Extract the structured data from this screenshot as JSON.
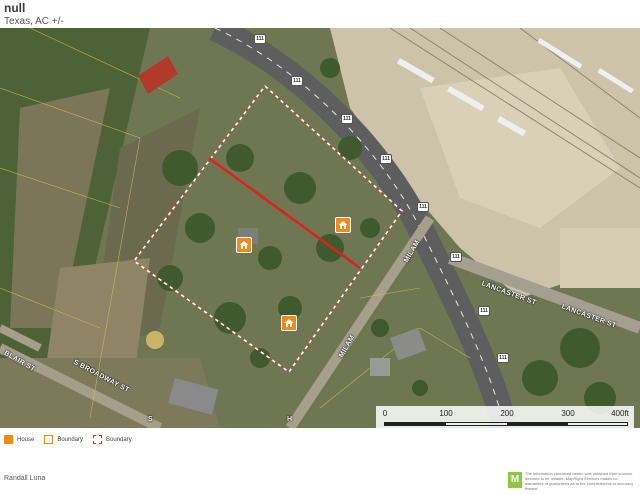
{
  "header": {
    "title": "null",
    "subtitle": "Texas,  AC +/-"
  },
  "map": {
    "road_labels": {
      "blair": "BLAIR ST",
      "broadway": "S BROADWAY ST",
      "milam": "MILAM",
      "lancaster_1": "LANCASTER ST",
      "lancaster_2": "LANCASTER ST",
      "s_label": "S",
      "h_label": "H"
    },
    "highway_shield": "111",
    "markers": [
      {
        "icon": "house-icon",
        "label": "House"
      },
      {
        "icon": "house-icon",
        "label": "House"
      },
      {
        "icon": "house-icon",
        "label": "House"
      }
    ],
    "colors": {
      "boundary_dashed": "#ffffff",
      "boundary_red": "#e02020",
      "marker": "#f08a1c"
    }
  },
  "scale": {
    "ticks": [
      "0",
      "100",
      "200",
      "300",
      "400ft"
    ]
  },
  "legend": [
    {
      "icon": "house-icon",
      "label": "House",
      "color": "#f08a1c"
    },
    {
      "icon": "boundary-icon",
      "label": "Boundary",
      "color": "#f08a1c"
    },
    {
      "icon": "boundary-icon",
      "label": "Boundary",
      "color": "#e02020"
    }
  ],
  "footer": {
    "author": "Randall Luna",
    "logo_letter": "M",
    "disclaimer": "The information contained herein was obtained from sources deemed to be reliable. MapRight Services makes no warranties or guarantees as to the completeness or accuracy thereof."
  }
}
